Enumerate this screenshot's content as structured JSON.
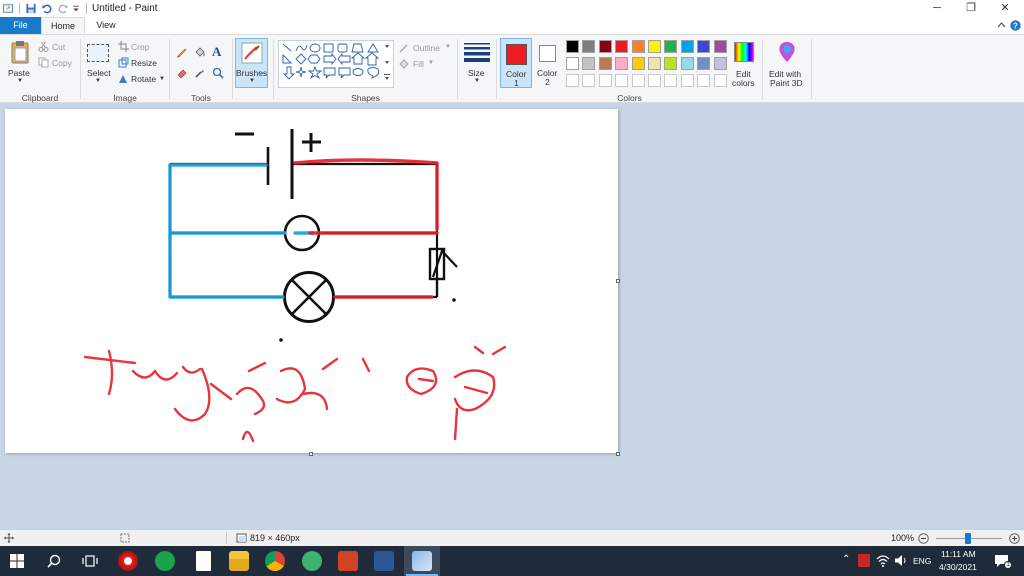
{
  "window": {
    "title": "Untitled - Paint",
    "min_glyph": "─",
    "restore_glyph": "❐",
    "close_glyph": "✕"
  },
  "tabs": {
    "file": "File",
    "home": "Home",
    "view": "View"
  },
  "clipboard": {
    "paste": "Paste",
    "cut": "Cut",
    "copy": "Copy",
    "label": "Clipboard"
  },
  "image": {
    "select": "Select",
    "crop": "Crop",
    "resize": "Resize",
    "rotate": "Rotate",
    "label": "Image"
  },
  "tools": {
    "label": "Tools",
    "text_glyph": "A"
  },
  "brushes": {
    "label": "Brushes"
  },
  "shapes": {
    "outline": "Outline",
    "fill": "Fill",
    "label": "Shapes"
  },
  "size": {
    "label": "Size"
  },
  "colors": {
    "color1_label": "Color",
    "color1_num": "1",
    "color2_label": "Color",
    "color2_num": "2",
    "edit_label_1": "Edit",
    "edit_label_2": "colors",
    "label": "Colors",
    "color1": "#ed1c24",
    "color2": "#ffffff",
    "palette_row1": [
      "#000000",
      "#7f7f7f",
      "#880015",
      "#ed1c24",
      "#ff7f27",
      "#fff200",
      "#22b14c",
      "#00a2e8",
      "#3f48cc",
      "#a349a4"
    ],
    "palette_row2": [
      "#ffffff",
      "#c3c3c3",
      "#b97a57",
      "#ffaec9",
      "#ffc90e",
      "#efe4b0",
      "#b5e61d",
      "#99d9ea",
      "#7092be",
      "#c8bfe7"
    ]
  },
  "paint3d": {
    "line1": "Edit with",
    "line2": "Paint 3D"
  },
  "status": {
    "dimensions": "819 × 460px",
    "zoom": "100%"
  },
  "tray": {
    "lang": "ENG",
    "time": "11:11 AM",
    "date": "4/30/2021"
  }
}
